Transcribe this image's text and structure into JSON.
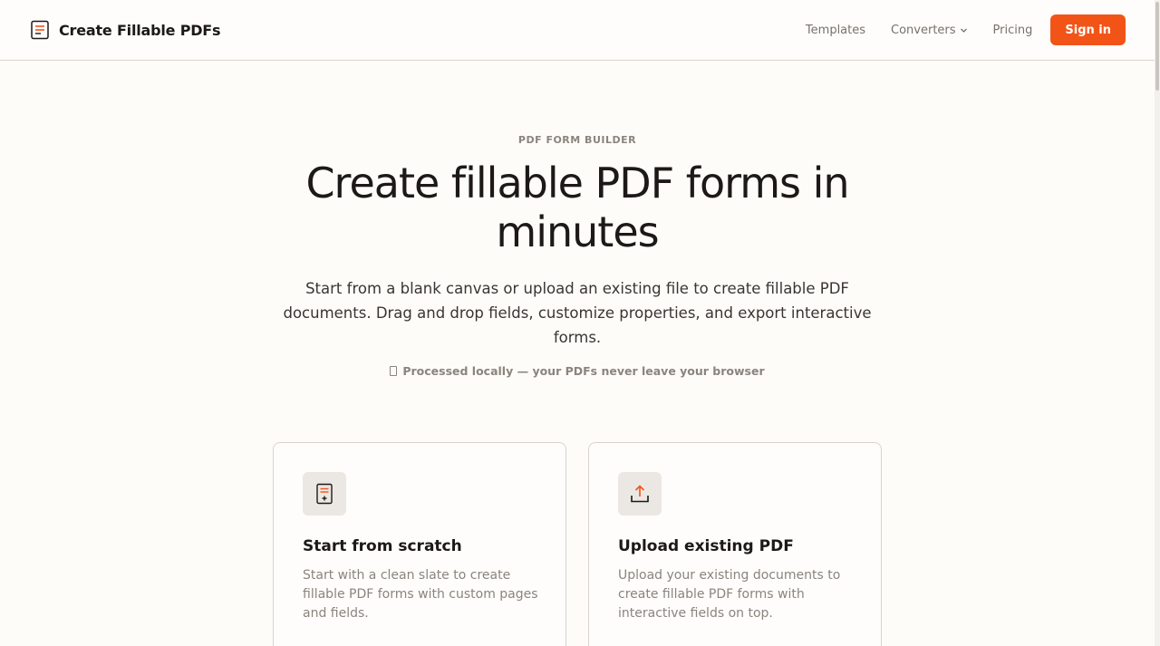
{
  "header": {
    "brand_name": "Create Fillable PDFs",
    "nav": {
      "templates": "Templates",
      "converters": "Converters",
      "pricing": "Pricing",
      "sign_in": "Sign in"
    }
  },
  "hero": {
    "eyebrow": "PDF FORM BUILDER",
    "title": "Create fillable PDF forms in minutes",
    "subtitle": "Start from a blank canvas or upload an existing file to create fillable PDF documents. Drag and drop fields, customize properties, and export interactive forms.",
    "note": "Processed locally — your PDFs never leave your browser"
  },
  "cards": [
    {
      "icon": "document-plus-icon",
      "title": "Start from scratch",
      "description": "Start with a clean slate to create fillable PDF forms with custom pages and fields."
    },
    {
      "icon": "upload-icon",
      "title": "Upload existing PDF",
      "description": "Upload your existing documents to create fillable PDF forms with interactive fields on top."
    }
  ],
  "colors": {
    "accent": "#f25418",
    "background": "#fdfcf9",
    "text": "#1c1917",
    "muted": "#8a847d",
    "border": "#d8d4cc"
  }
}
